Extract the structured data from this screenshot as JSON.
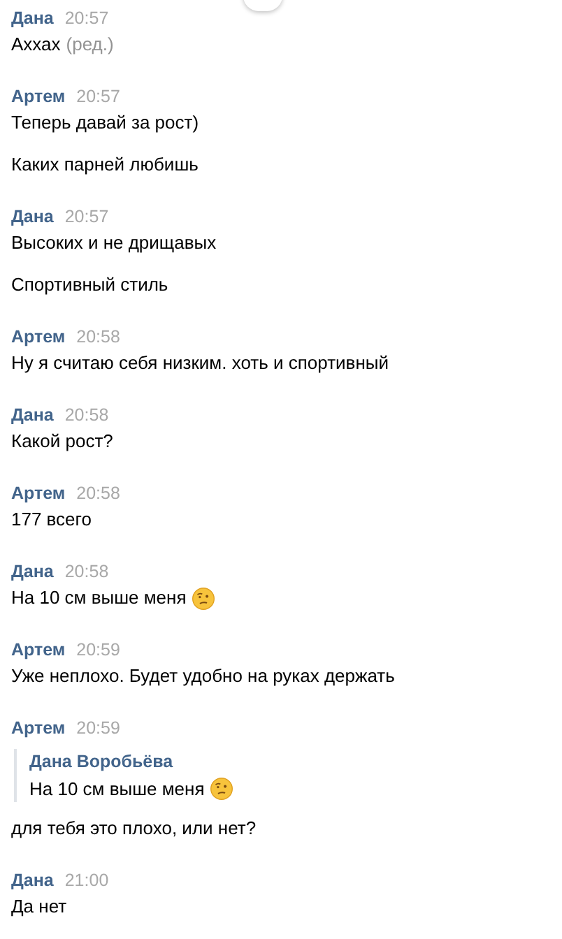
{
  "groups": [
    {
      "author": "Дана",
      "time": "20:57",
      "messages": [
        {
          "kind": "text",
          "text": "Аххах",
          "edited": "(ред.)"
        }
      ]
    },
    {
      "author": "Артем",
      "time": "20:57",
      "messages": [
        {
          "kind": "text",
          "text": "Теперь давай за рост)"
        },
        {
          "kind": "text",
          "text": "Каких парней любишь"
        }
      ]
    },
    {
      "author": "Дана",
      "time": "20:57",
      "messages": [
        {
          "kind": "text",
          "text": "Высоких и не дрищавых"
        },
        {
          "kind": "text",
          "text": "Спортивный стиль"
        }
      ]
    },
    {
      "author": "Артем",
      "time": "20:58",
      "messages": [
        {
          "kind": "text",
          "text": "Ну я считаю себя низким. хоть и спортивный"
        }
      ]
    },
    {
      "author": "Дана",
      "time": "20:58",
      "messages": [
        {
          "kind": "text",
          "text": "Какой рост?"
        }
      ]
    },
    {
      "author": "Артем",
      "time": "20:58",
      "messages": [
        {
          "kind": "text",
          "text": "177 всего"
        }
      ]
    },
    {
      "author": "Дана",
      "time": "20:58",
      "messages": [
        {
          "kind": "text",
          "text": "На 10 см выше меня",
          "emoji": true
        }
      ]
    },
    {
      "author": "Артем",
      "time": "20:59",
      "messages": [
        {
          "kind": "text",
          "text": "Уже неплохо. Будет удобно на руках держать"
        }
      ]
    },
    {
      "author": "Артем",
      "time": "20:59",
      "messages": [
        {
          "kind": "quote",
          "quote_author": "Дана Воробьёва",
          "quote_text": "На 10 см выше меня",
          "emoji": true,
          "text": "для тебя это плохо, или нет?"
        }
      ]
    },
    {
      "author": "Дана",
      "time": "21:00",
      "messages": [
        {
          "kind": "text",
          "text": "Да нет"
        }
      ]
    }
  ]
}
